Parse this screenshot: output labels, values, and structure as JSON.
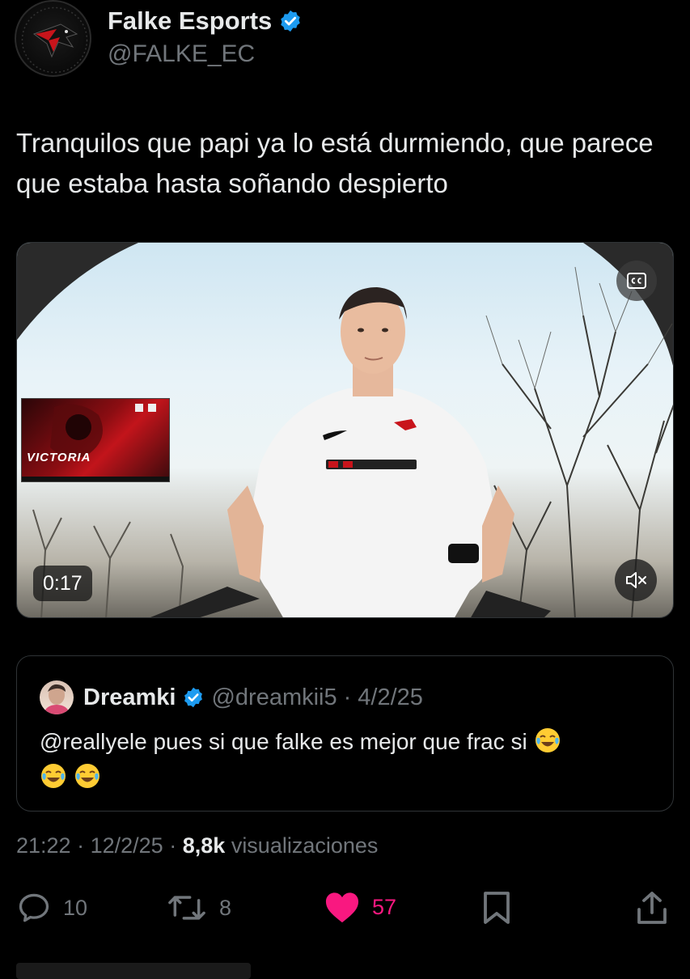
{
  "author": {
    "display_name": "Falke Esports",
    "handle": "@FALKE_EC",
    "verified": true,
    "verified_color": "#1d9bf0"
  },
  "tweet": {
    "text": "Tranquilos que papi ya lo está durmiendo, que parece que estaba hasta soñando despierto"
  },
  "media": {
    "duration": "0:17",
    "cc_icon": "closed-captions-icon",
    "mute_icon": "volume-muted-icon",
    "inset_text": "VICTORIA"
  },
  "quote": {
    "display_name": "Dreamki",
    "handle": "@dreamkii5",
    "separator": "·",
    "date": "4/2/25",
    "text": "@reallyele pues si que falke es mejor que frac si"
  },
  "meta": {
    "time": "21:22",
    "sep1": "·",
    "date": "12/2/25",
    "sep2": "·",
    "views": "8,8k",
    "views_label": "visualizaciones"
  },
  "actions": {
    "replies": "10",
    "retweets": "8",
    "likes": "57",
    "like_color": "#f91880"
  }
}
